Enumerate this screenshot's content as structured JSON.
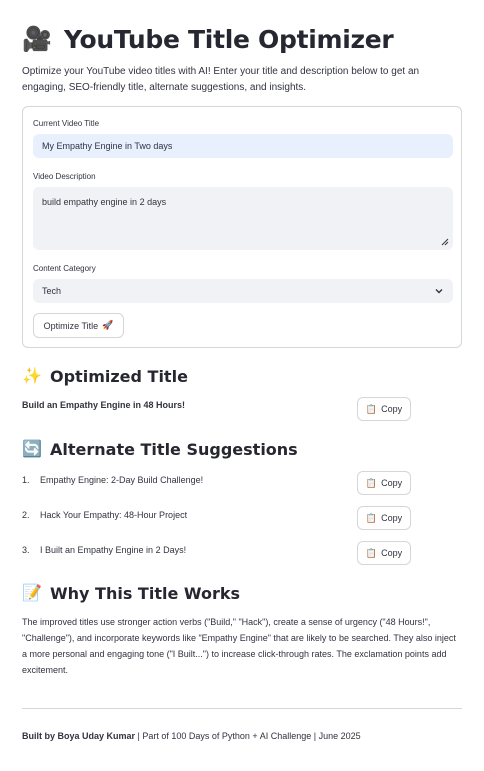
{
  "app": {
    "title_icon": "film-camera-icon",
    "title": "YouTube Title Optimizer",
    "intro": "Optimize your YouTube video titles with AI! Enter your title and description below to get an engaging, SEO-friendly title, alternate suggestions, and insights."
  },
  "form": {
    "title_label": "Current Video Title",
    "title_value": "My Empathy Engine in Two days",
    "description_label": "Video Description",
    "description_value": "build empathy engine in 2 days",
    "category_label": "Content Category",
    "category_value": "Tech",
    "submit_label": "Optimize Title",
    "submit_icon": "🚀"
  },
  "optimized": {
    "heading_icon": "✨",
    "heading": "Optimized Title",
    "title": "Build an Empathy Engine in 48 Hours!",
    "copy_label": "Copy",
    "copy_icon": "📋"
  },
  "alternates": {
    "heading_icon": "🔄",
    "heading": "Alternate Title Suggestions",
    "items": [
      {
        "num": "1.",
        "text": "Empathy Engine: 2-Day Build Challenge!",
        "copy_label": "Copy"
      },
      {
        "num": "2.",
        "text": "Hack Your Empathy: 48-Hour Project",
        "copy_label": "Copy"
      },
      {
        "num": "3.",
        "text": "I Built an Empathy Engine in 2 Days!",
        "copy_label": "Copy"
      }
    ]
  },
  "why": {
    "heading_icon": "📝",
    "heading": "Why This Title Works",
    "text": "The improved titles use stronger action verbs (\"Build,\" \"Hack\"), create a sense of urgency (\"48 Hours!\", \"Challenge\"), and incorporate keywords like \"Empathy Engine\" that are likely to be searched. They also inject a more personal and engaging tone (\"I Built...\") to increase click-through rates. The exclamation points add excitement."
  },
  "footer": {
    "author": "Built by Boya Uday Kumar",
    "rest": " | Part of 100 Days of Python + AI Challenge | June 2025"
  }
}
